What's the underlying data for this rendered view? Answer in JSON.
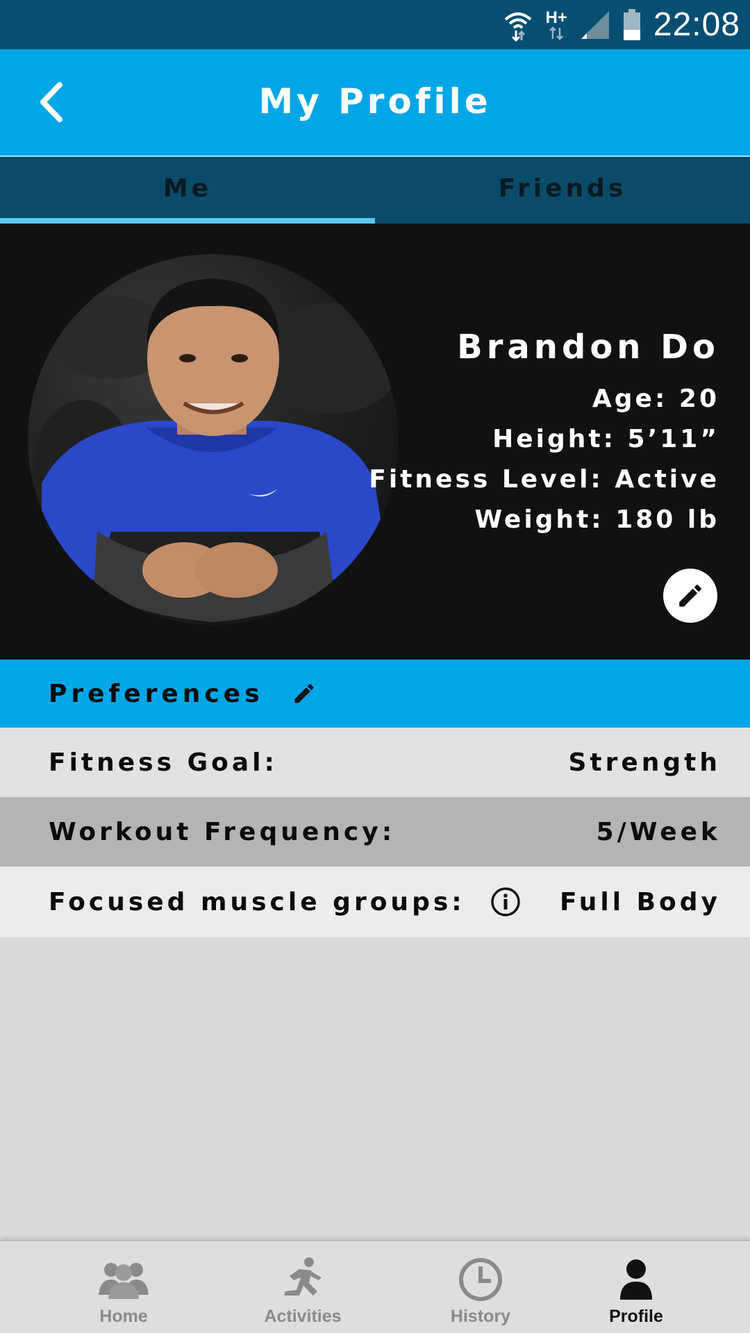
{
  "status_bar": {
    "network_type": "H+",
    "time": "22:08"
  },
  "header": {
    "title": "My Profile",
    "back_icon": "chevron-left-icon"
  },
  "tabs": [
    {
      "label": "Me",
      "active": true
    },
    {
      "label": "Friends",
      "active": false
    }
  ],
  "profile": {
    "name": "Brandon Do",
    "age": "Age: 20",
    "height": "Height: 5’11”",
    "fitness_level": "Fitness Level: Active",
    "weight": "Weight: 180 lb",
    "edit_icon": "pencil-icon"
  },
  "preferences": {
    "title": "Preferences",
    "rows": [
      {
        "label": "Fitness Goal:",
        "value": "Strength"
      },
      {
        "label": "Workout Frequency:",
        "value": "5/Week"
      },
      {
        "label": "Focused muscle groups:",
        "value": "Full Body",
        "icon": "info-icon"
      }
    ]
  },
  "bottom_nav": [
    {
      "label": "Home",
      "icon": "group-icon",
      "active": false
    },
    {
      "label": "Activities",
      "icon": "running-person-icon",
      "active": false
    },
    {
      "label": "History",
      "icon": "clock-icon",
      "active": false
    },
    {
      "label": "Profile",
      "icon": "person-icon",
      "active": true
    }
  ],
  "colors": {
    "status_bar": "#064f73",
    "primary": "#00a6e6",
    "tab_bar": "#0a4b69",
    "tab_indicator": "#5cc8f5",
    "profile_card": "#111111"
  }
}
